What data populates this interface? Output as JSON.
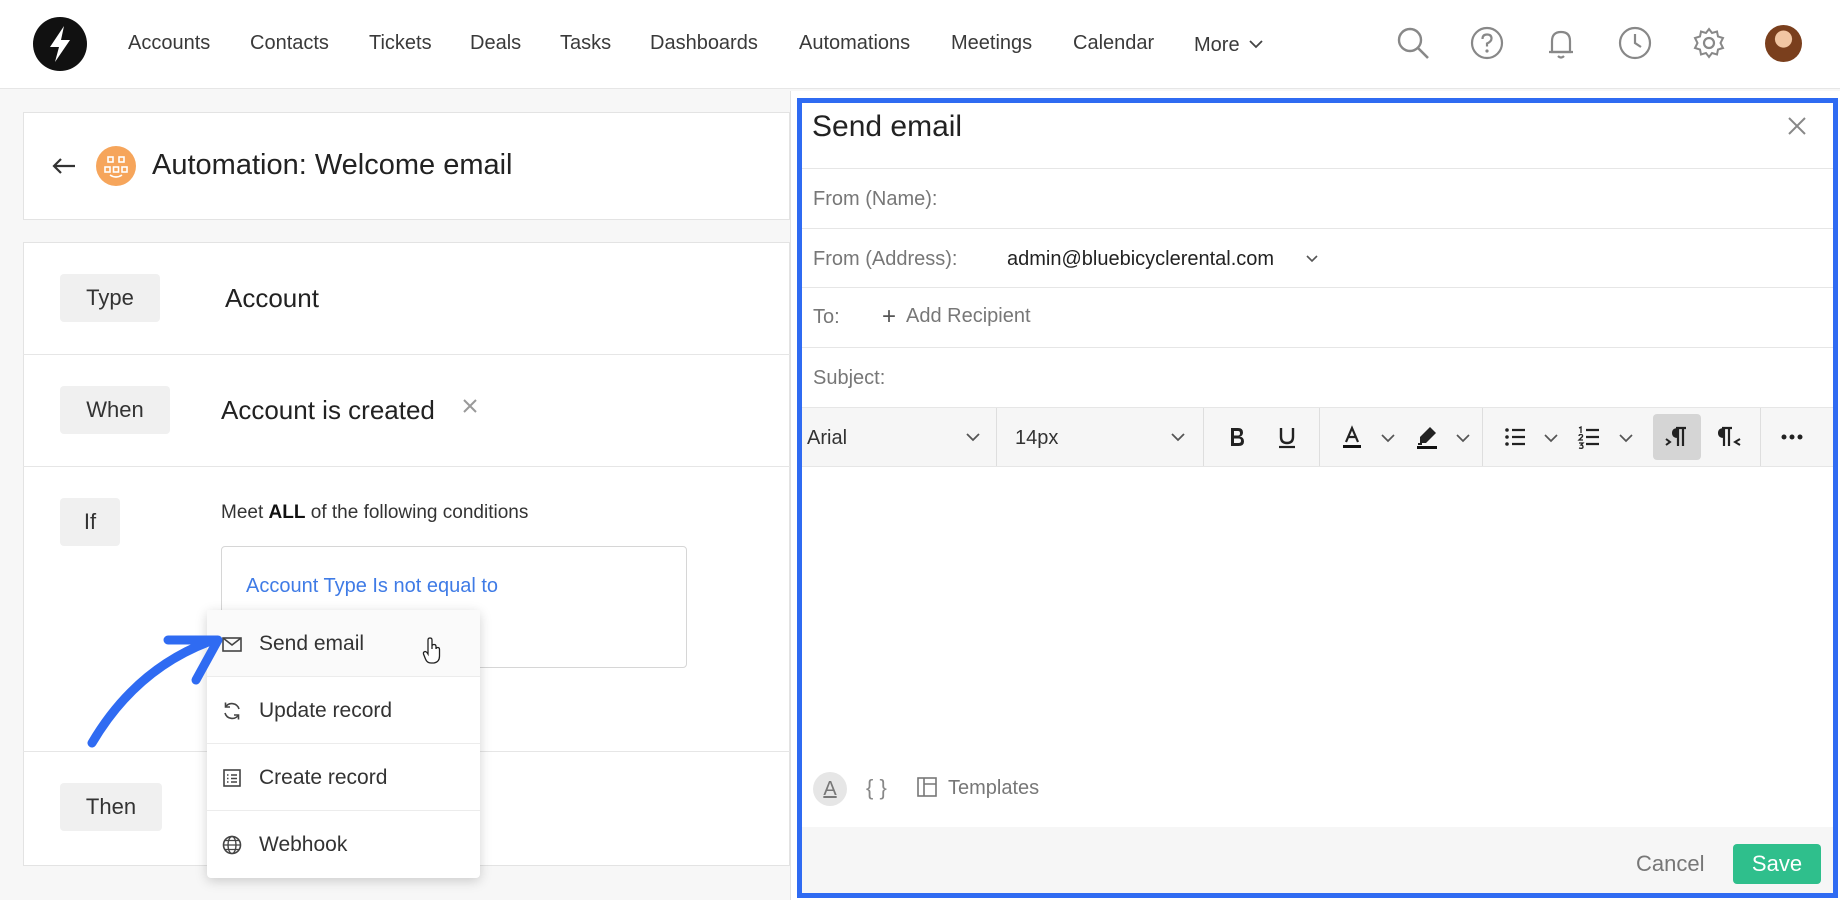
{
  "nav": {
    "items": [
      "Accounts",
      "Contacts",
      "Tickets",
      "Deals",
      "Tasks",
      "Dashboards",
      "Automations",
      "Meetings",
      "Calendar"
    ],
    "more_label": "More"
  },
  "automation": {
    "title": "Automation: Welcome email",
    "type_label": "Type",
    "type_value": "Account",
    "when_label": "When",
    "when_value": "Account is created",
    "if_label": "If",
    "meet_prefix": "Meet",
    "meet_bold": "ALL",
    "meet_suffix": "of the following conditions",
    "condition_text": "Account Type Is not equal to",
    "then_label": "Then"
  },
  "action_menu": {
    "items": [
      "Send email",
      "Update record",
      "Create record",
      "Webhook"
    ]
  },
  "send_email": {
    "title": "Send email",
    "from_name_label": "From (Name):",
    "from_address_label": "From (Address):",
    "from_address_value": "admin@bluebicyclerental.com",
    "to_label": "To:",
    "add_recipient": "Add Recipient",
    "subject_label": "Subject:",
    "font_value": "Arial",
    "size_value": "14px",
    "braces": "{ }",
    "templates_label": "Templates",
    "cancel_label": "Cancel",
    "save_label": "Save",
    "text_format_glyph": "A"
  },
  "colors": {
    "accent_blue": "#2f6bf2",
    "condition_link": "#3f7be6",
    "save_green": "#2fbf8c",
    "automation_icon": "#f6a55b"
  }
}
